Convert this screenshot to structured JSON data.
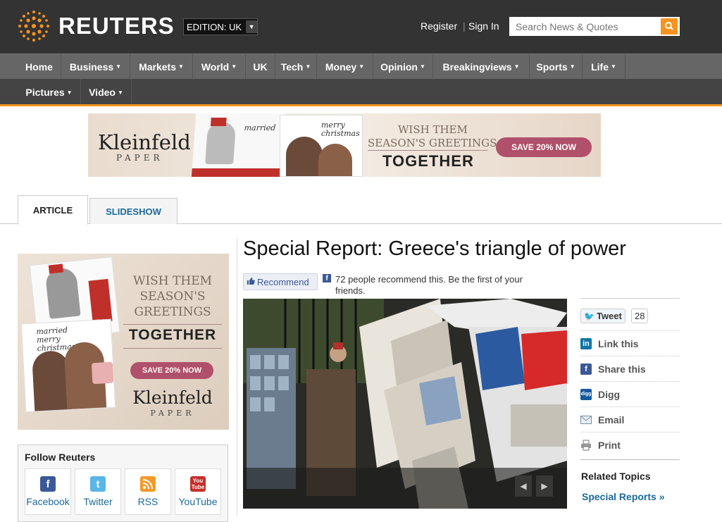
{
  "header": {
    "logo_text": "REUTERS",
    "edition_label": "EDITION:",
    "edition_value": "UK",
    "register": "Register",
    "sign_in": "Sign In",
    "search_placeholder": "Search News & Quotes"
  },
  "nav": {
    "primary": [
      {
        "label": "Home",
        "caret": false
      },
      {
        "label": "Business",
        "caret": true
      },
      {
        "label": "Markets",
        "caret": true
      },
      {
        "label": "World",
        "caret": true
      },
      {
        "label": "UK",
        "caret": false
      },
      {
        "label": "Tech",
        "caret": true
      },
      {
        "label": "Money",
        "caret": true
      },
      {
        "label": "Opinion",
        "caret": true
      },
      {
        "label": "Breakingviews",
        "caret": true
      },
      {
        "label": "Sports",
        "caret": true
      },
      {
        "label": "Life",
        "caret": true
      }
    ],
    "secondary": [
      {
        "label": "Pictures",
        "caret": true
      },
      {
        "label": "Video",
        "caret": true
      }
    ]
  },
  "ad_top": {
    "brand": "Kleinfeld",
    "brand_sub": "PAPER",
    "line1": "WISH THEM",
    "line2": "SEASON'S GREETINGS",
    "line3": "TOGETHER",
    "cta": "SAVE 20% NOW",
    "card1": "married",
    "card2": "merry christmas"
  },
  "tabs": {
    "article": "ARTICLE",
    "slideshow": "SLIDESHOW"
  },
  "side_ad": {
    "line1": "WISH THEM",
    "line2": "SEASON'S",
    "line3": "GREETINGS",
    "line4": "TOGETHER",
    "cta": "SAVE 20% NOW",
    "brand": "Kleinfeld",
    "brand_sub": "PAPER",
    "card_text": "married merry christmas"
  },
  "follow": {
    "title": "Follow Reuters",
    "items": [
      "Facebook",
      "Twitter",
      "RSS",
      "YouTube"
    ]
  },
  "article": {
    "headline": "Special Report: Greece's triangle of power",
    "recommend_button": "Recommend",
    "recommend_text": "72 people recommend this. Be the first of your friends."
  },
  "share": {
    "tweet_label": "Tweet",
    "tweet_count": "28",
    "items": [
      "Link this",
      "Share this",
      "Digg",
      "Email",
      "Print"
    ],
    "related_title": "Related Topics",
    "related_link": "Special Reports »"
  },
  "colors": {
    "accent": "#f7941d",
    "link": "#1a6a9a",
    "topbar": "#333333"
  }
}
